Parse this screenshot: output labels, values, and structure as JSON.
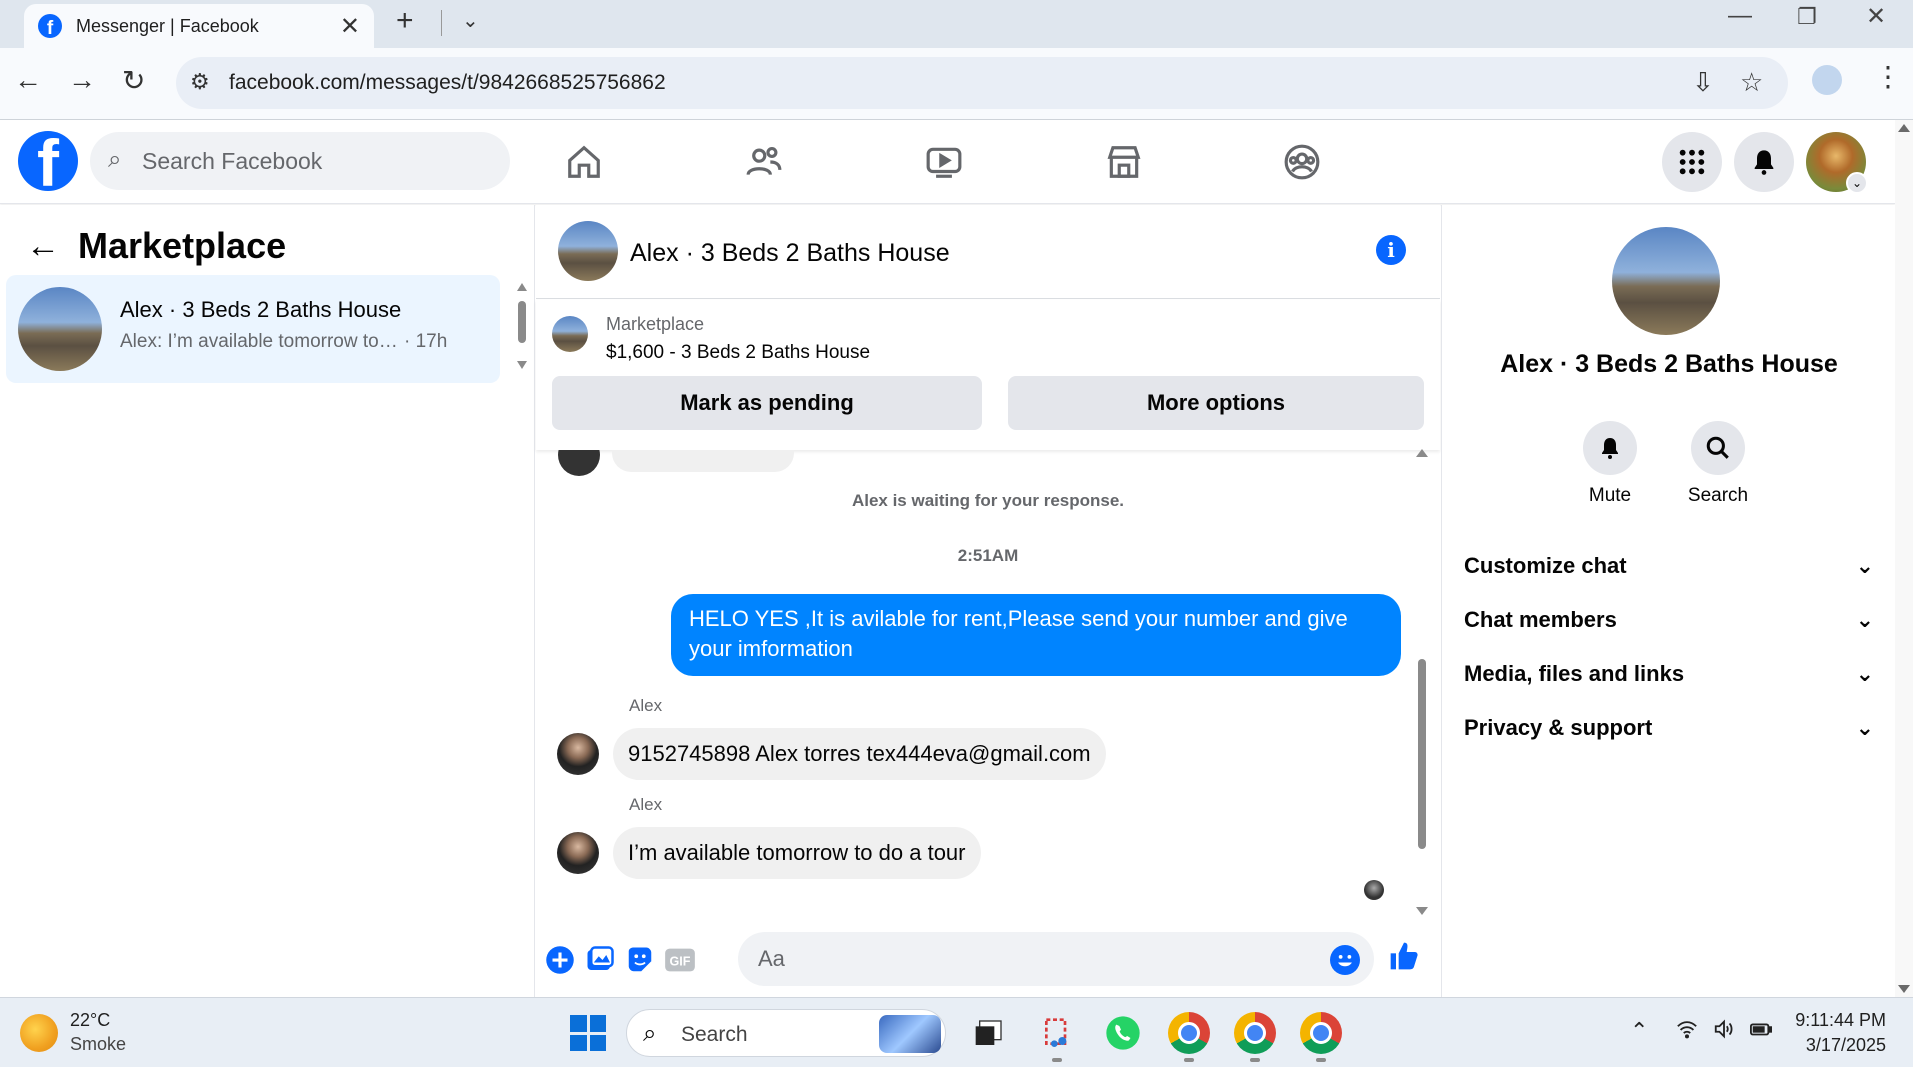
{
  "browser": {
    "tab_title": "Messenger | Facebook",
    "url": "facebook.com/messages/t/9842668525756862"
  },
  "fbnav": {
    "search_placeholder": "Search Facebook"
  },
  "left": {
    "title": "Marketplace",
    "conversations": [
      {
        "name": "Alex · 3 Beds 2 Baths House",
        "preview": "Alex: I’m available tomorrow to do a tour",
        "time": "· 17h"
      }
    ]
  },
  "chat": {
    "title": "Alex · 3 Beds 2 Baths House",
    "marketplace_label": "Marketplace",
    "listing": "$1,600 - 3 Beds 2 Baths House",
    "mark_pending": "Mark as pending",
    "more_options": "More options",
    "status": "Alex is waiting for your response.",
    "timestamp": "2:51AM",
    "messages": [
      {
        "from": "me",
        "text": "HELO YES ,It is avilable for rent,Please send your number and give your imformation"
      },
      {
        "from": "Alex",
        "text": "9152745898 Alex torres tex444eva@gmail.com"
      },
      {
        "from": "Alex",
        "text": "I’m available tomorrow to do a tour"
      }
    ],
    "input_placeholder": "Aa",
    "gif_label": "GIF"
  },
  "right": {
    "title": "Alex · 3 Beds 2 Baths House",
    "mute": "Mute",
    "search": "Search",
    "sections": [
      "Customize chat",
      "Chat members",
      "Media, files and links",
      "Privacy & support"
    ]
  },
  "taskbar": {
    "temp": "22°C",
    "weather": "Smoke",
    "search": "Search",
    "time": "9:11:44 PM",
    "date": "3/17/2025"
  },
  "colors": {
    "fb_blue": "#0866ff",
    "bubble_blue": "#0084ff",
    "selected_bg": "#ebf5ff"
  }
}
